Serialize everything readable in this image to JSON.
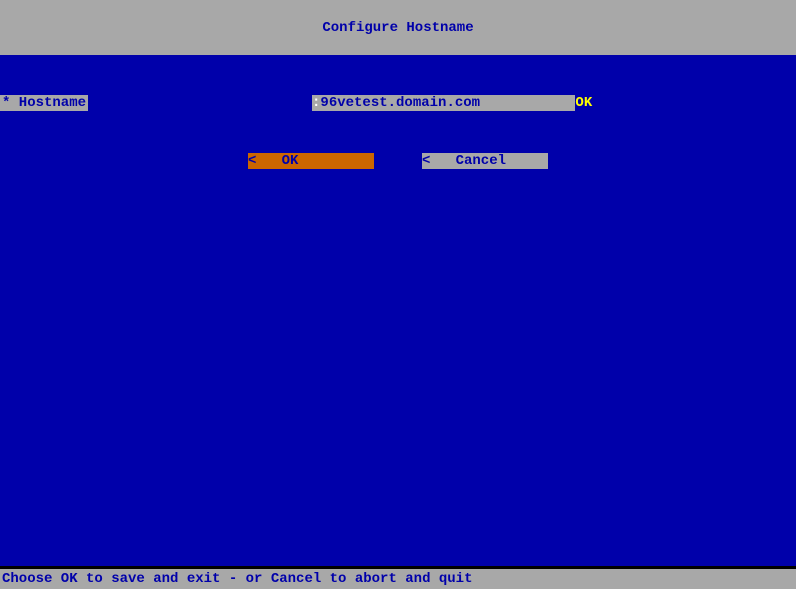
{
  "header": {
    "title": "Configure Hostname"
  },
  "form": {
    "hostname": {
      "label": "* Hostname",
      "separator": ": ",
      "value": "96vetest.domain.com",
      "status": "OK"
    }
  },
  "buttons": {
    "ok": "<   OK          >",
    "cancel": "<   Cancel      >"
  },
  "footer": {
    "hint": "Choose OK to save and exit - or Cancel to abort and quit"
  }
}
